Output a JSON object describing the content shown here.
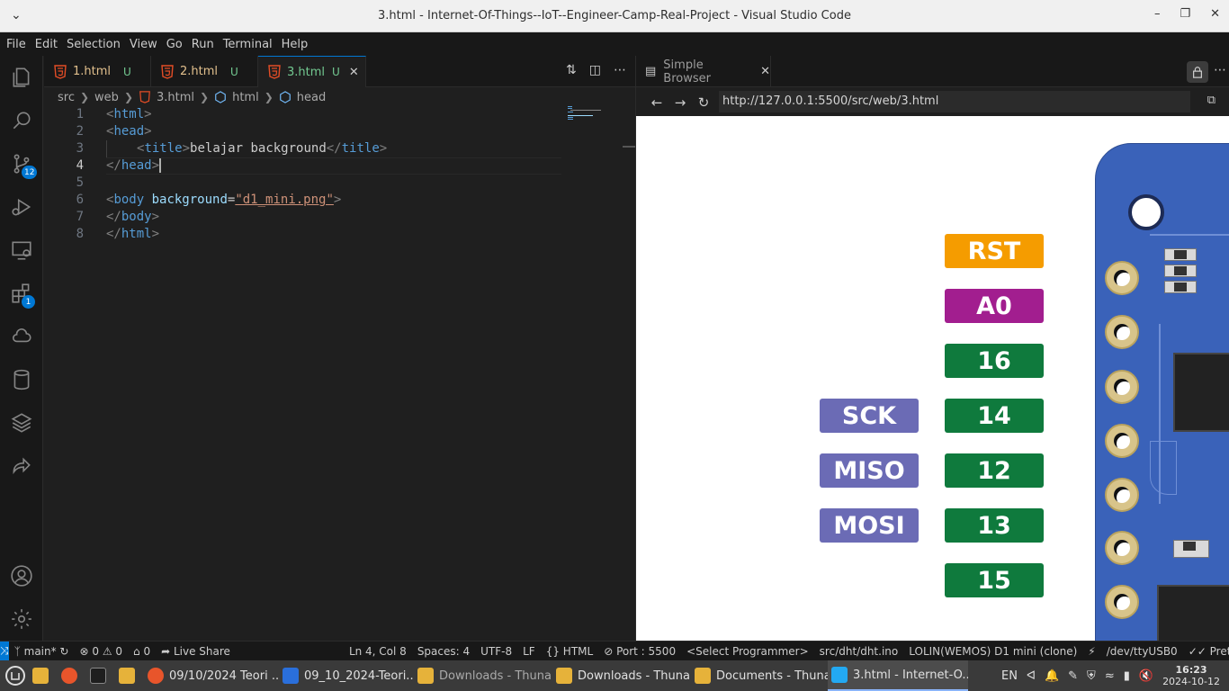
{
  "window": {
    "title": "3.html - Internet-Of-Things--IoT--Engineer-Camp-Real-Project - Visual Studio Code"
  },
  "menu": [
    "File",
    "Edit",
    "Selection",
    "View",
    "Go",
    "Run",
    "Terminal",
    "Help"
  ],
  "activity": {
    "scm_badge": "12",
    "extensions_badge": "1"
  },
  "tabs": [
    {
      "label": "1.html",
      "status": "U"
    },
    {
      "label": "2.html",
      "status": "U"
    },
    {
      "label": "3.html",
      "status": "U"
    }
  ],
  "breadcrumb": [
    "src",
    "web",
    "3.html",
    "html",
    "head"
  ],
  "code": {
    "line_numbers": [
      "1",
      "2",
      "3",
      "4",
      "5",
      "6",
      "7",
      "8"
    ],
    "title_text": "belajar background",
    "body_attr": "background",
    "body_attr_value": "\"d1_mini.png\""
  },
  "browser": {
    "tab_label": "Simple Browser",
    "url": "http://127.0.0.1:5500/src/web/3.html",
    "pins": [
      {
        "label": "RST",
        "color": "#f59c00"
      },
      {
        "label": "A0",
        "color": "#a21e8f"
      },
      {
        "label": "16",
        "color": "#0f7a3d"
      },
      {
        "label": "14",
        "color": "#0f7a3d"
      },
      {
        "label": "12",
        "color": "#0f7a3d"
      },
      {
        "label": "13",
        "color": "#0f7a3d"
      },
      {
        "label": "15",
        "color": "#0f7a3d"
      }
    ],
    "func_pins": [
      {
        "label": "SCK",
        "color": "#6b6bb5"
      },
      {
        "label": "MISO",
        "color": "#6b6bb5"
      },
      {
        "label": "MOSI",
        "color": "#6b6bb5"
      }
    ]
  },
  "status": {
    "branch": "main*",
    "errors": "0",
    "warnings": "0",
    "ports": "0",
    "live_share": "Live Share",
    "position": "Ln 4, Col 8",
    "spaces": "Spaces: 4",
    "encoding": "UTF-8",
    "eol": "LF",
    "language": "HTML",
    "port": "Port : 5500",
    "programmer": "<Select Programmer>",
    "sketch": "src/dht/dht.ino",
    "board": "LOLIN(WEMOS) D1 mini (clone)",
    "serial": "/dev/ttyUSB0",
    "prettier": "Prettier"
  },
  "taskbar": {
    "apps": [
      {
        "label": "09/10/2024 Teori ...",
        "color": "#e8552b"
      },
      {
        "label": "09_10_2024-Teori...",
        "color": "#2a6fdb"
      },
      {
        "label": "Downloads - Thunar",
        "color": "#e6b23a"
      },
      {
        "label": "Downloads - Thunar",
        "color": "#e6b23a"
      },
      {
        "label": "Documents - Thunar",
        "color": "#e6b23a"
      },
      {
        "label": "3.html - Internet-O...",
        "color": "#23a9f2"
      }
    ],
    "lang": "EN",
    "time": "16:23",
    "date": "2024-10-12"
  }
}
